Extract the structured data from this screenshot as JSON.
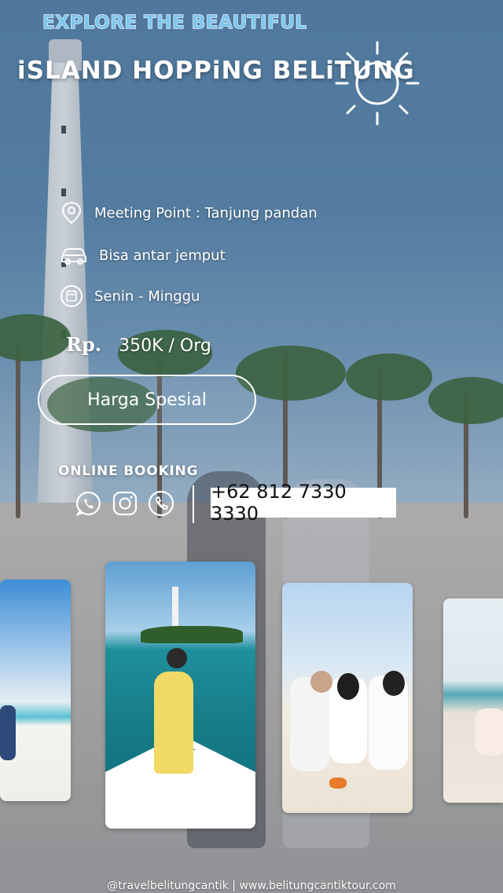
{
  "headline": {
    "top": "EXPLORE THE BEAUTIFUL",
    "main": "iSLAND HOPPiNG BELiTUNG"
  },
  "info": [
    {
      "icon": "location-pin-icon",
      "text": "Meeting Point : Tanjung pandan"
    },
    {
      "icon": "car-icon",
      "text": "Bisa antar jemput"
    },
    {
      "icon": "calendar-icon",
      "text": "Senin - Minggu"
    }
  ],
  "price": {
    "currency": "Rp.",
    "amount": "350K / Org"
  },
  "special_button": "Harga Spesial",
  "booking": {
    "label": "ONLINE BOOKING",
    "icons": [
      "whatsapp-icon",
      "instagram-icon",
      "phone-icon"
    ],
    "phone": "+62 812 7330 3330"
  },
  "footer": "@travelbelitungcantik | www.belitungcantiktour.com",
  "colors": {
    "headline_accent": "#7fc6ee",
    "text": "#ffffff"
  }
}
